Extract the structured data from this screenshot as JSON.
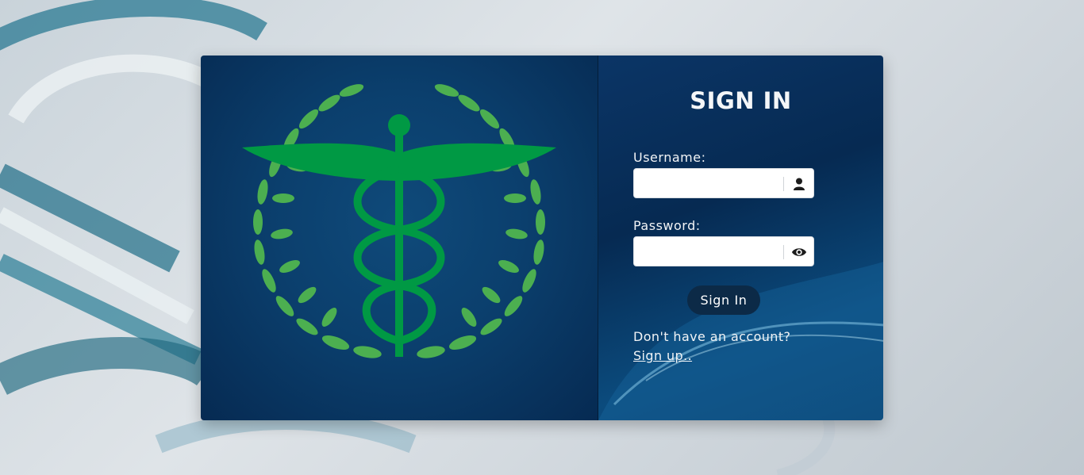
{
  "form": {
    "title": "SIGN IN",
    "username_label": "Username:",
    "username_value": "",
    "password_label": "Password:",
    "password_value": "",
    "submit_label": "Sign In",
    "no_account_text": "Don't have an account?",
    "signup_link": "Sign up.."
  },
  "icons": {
    "username": "user-icon",
    "password": "eye-icon",
    "emblem": "caduceus-laurel-emblem"
  },
  "colors": {
    "panel_dark": "#062a52",
    "emblem_green": "#009944",
    "laurel_green": "#4caf50",
    "button": "#0c2a47"
  }
}
